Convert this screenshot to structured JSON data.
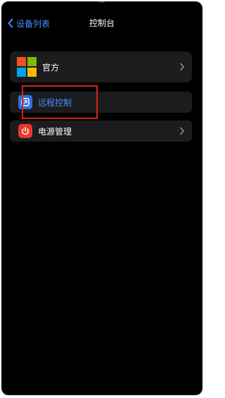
{
  "nav": {
    "back_label": "设备列表",
    "title": "控制台"
  },
  "items": [
    {
      "label": "官方",
      "icon": "microsoft-logo-icon"
    },
    {
      "label": "远程控制",
      "icon": "remote-control-icon"
    },
    {
      "label": "电源管理",
      "icon": "power-icon"
    }
  ],
  "colors": {
    "background": "#000000",
    "row_background": "#1c1c1e",
    "accent_blue": "#4a8fff",
    "highlight_red": "#d2241c",
    "power_red": "#e8382e",
    "ms_red": "#f25022",
    "ms_green": "#7fba00",
    "ms_blue": "#00a4ef",
    "ms_yellow": "#ffb900"
  }
}
